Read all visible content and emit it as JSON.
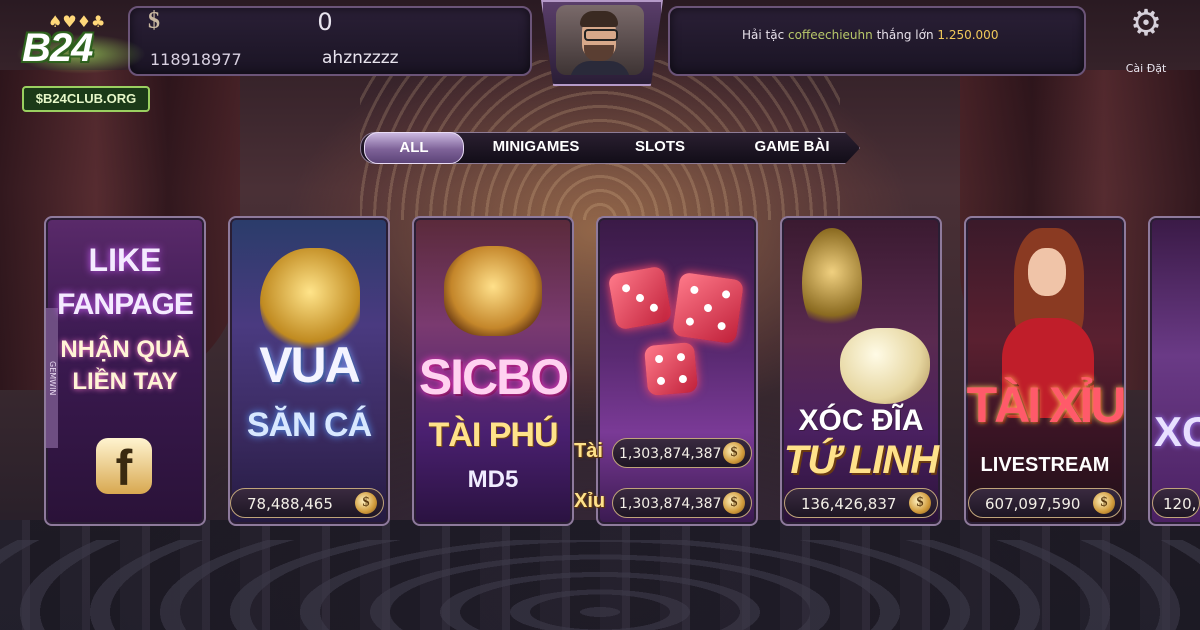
{
  "header": {
    "balance": "0",
    "id_prefix": ":D:",
    "user_id": "118918977",
    "username": "ahznzzzz",
    "ticker": {
      "prefix": "Hải tặc",
      "user": "coffeechieuhn",
      "middle": "thắng lớn",
      "amount": "1.250.000"
    },
    "settings_label": "Cài Đặt"
  },
  "logo": {
    "text": "B24",
    "club": "$B24CLUB.ORG"
  },
  "tabs": [
    {
      "label": "ALL",
      "active": true
    },
    {
      "label": "MINIGAMES",
      "active": false
    },
    {
      "label": "SLOTS",
      "active": false
    },
    {
      "label": "GAME BÀI",
      "active": false
    }
  ],
  "games": {
    "fanpage": {
      "line1": "LIKE",
      "line2": "FANPAGE",
      "line3": "NHẬN QUÀ",
      "line4": "LIỀN TAY",
      "side_text": "GEMWIN"
    },
    "vua_san_ca": {
      "line1": "VUA",
      "line2": "SĂN CÁ",
      "jackpot": "78,488,465"
    },
    "sicbo": {
      "line1": "SICBO",
      "line2": "TÀI PHÚ",
      "line3": "MD5"
    },
    "tai_xiu": {
      "tai_label": "Tài",
      "tai_jackpot": "1,303,874,387",
      "xiu_label": "Xỉu",
      "xiu_jackpot": "1,303,874,387"
    },
    "xoc_dia": {
      "line1": "XÓC ĐĨA",
      "line2": "TỨ LINH",
      "jackpot": "136,426,837"
    },
    "tai_xiu_live": {
      "line1": "TÀI XỈU",
      "line2": "LIVESTREAM",
      "jackpot": "607,097,590"
    },
    "partial": {
      "line1": "XC",
      "jackpot": "120,"
    }
  },
  "icons": {
    "coin": "dollar-coin-icon",
    "settings": "gear-icon",
    "facebook": "facebook-icon"
  }
}
